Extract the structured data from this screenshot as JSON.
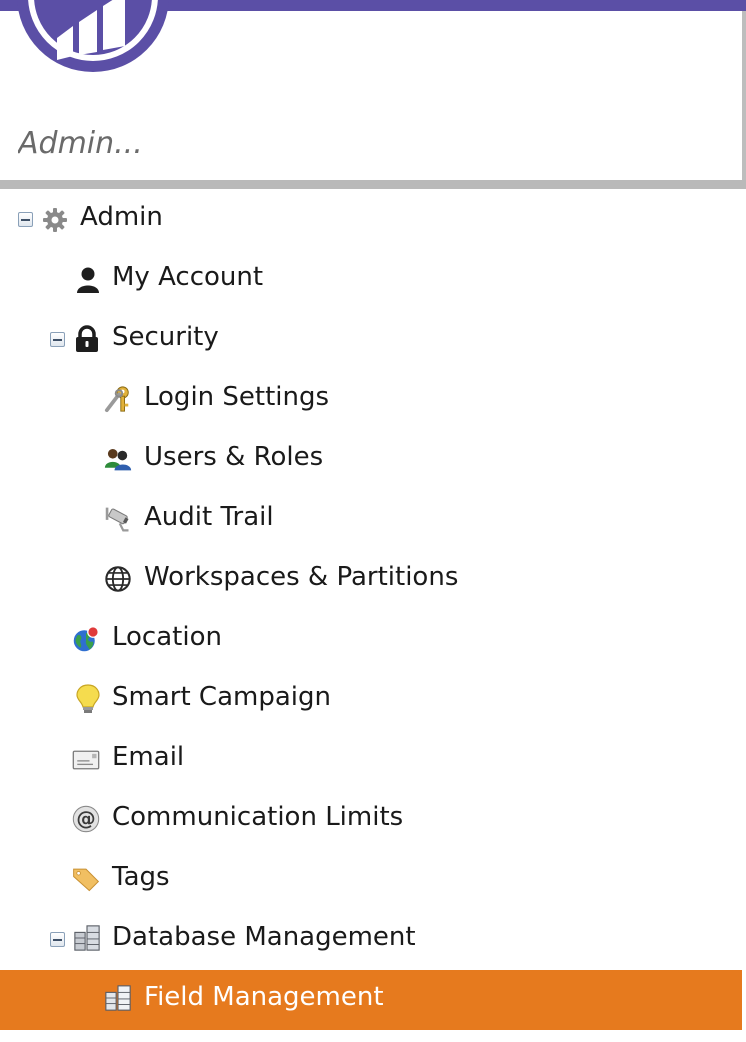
{
  "header": {
    "search_placeholder": "Admin..."
  },
  "tree": {
    "admin": "Admin",
    "my_account": "My Account",
    "security": "Security",
    "login_settings": "Login Settings",
    "users_roles": "Users & Roles",
    "audit_trail": "Audit Trail",
    "workspaces": "Workspaces & Partitions",
    "location": "Location",
    "smart_campaign": "Smart Campaign",
    "email": "Email",
    "communication_limits": "Communication Limits",
    "tags": "Tags",
    "database_management": "Database Management",
    "field_management": "Field Management"
  },
  "colors": {
    "brand": "#5b4fa6",
    "selected": "#e67a1e"
  }
}
